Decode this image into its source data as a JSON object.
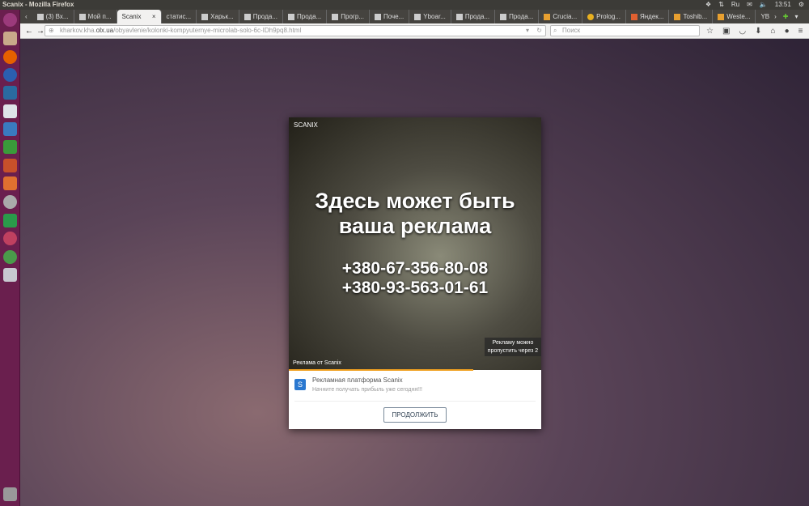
{
  "window_title": "Scanix - Mozilla Firefox",
  "indicators": {
    "lang": "Ru",
    "time": "13:51"
  },
  "tabs": [
    {
      "label": "(3) Вх..."
    },
    {
      "label": "Мой п..."
    },
    {
      "label": "Scanix",
      "active": true
    },
    {
      "label": "статис..."
    },
    {
      "label": "Харьк..."
    },
    {
      "label": "Прода..."
    },
    {
      "label": "Прода..."
    },
    {
      "label": "Прогр..."
    },
    {
      "label": "Поче..."
    },
    {
      "label": "Yboar..."
    },
    {
      "label": "Прода..."
    },
    {
      "label": "Прода..."
    },
    {
      "label": "Crucia..."
    },
    {
      "label": "Prolog..."
    },
    {
      "label": "Яндек..."
    },
    {
      "label": "Toshib..."
    },
    {
      "label": "Weste..."
    },
    {
      "label": "YB"
    }
  ],
  "url": {
    "prefix": "kharkov.kha.",
    "domain": "olx.ua",
    "path": "/obyavlenie/kolonki-kompyuternye-microlab-solo-6c-IDh9pq8.html"
  },
  "search_placeholder": "Поиск",
  "ad": {
    "brand": "SCANIX",
    "headline": "Здесь может быть ваша реклама",
    "phone1": "+380-67-356-80-08",
    "phone2": "+380-93-563-01-61",
    "skip": "Рекламу можно пропустить через 2",
    "ad_from": "Реклама от Scanix",
    "progress": 0.73,
    "platform_title": "Рекламная платформа Scanix",
    "platform_sub": "Начните получать прибыль уже сегодня!!!",
    "continue": "ПРОДОЛЖИТЬ"
  }
}
